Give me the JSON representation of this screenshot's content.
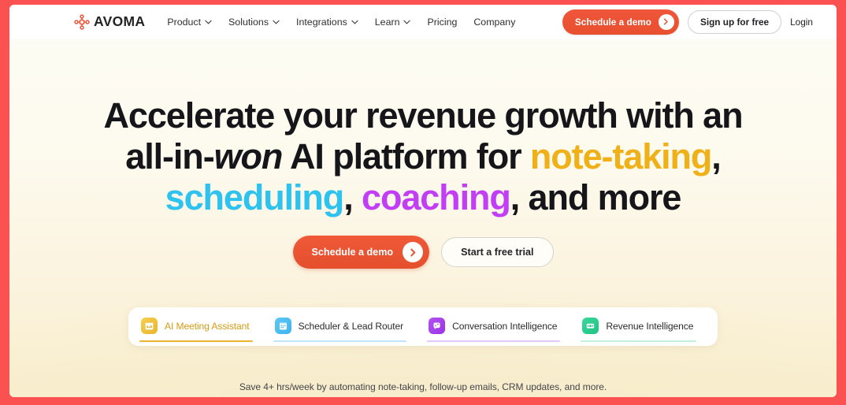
{
  "nav": {
    "brand": {
      "name": "AVOMA",
      "icon": "avoma-logo-icon"
    },
    "links": [
      {
        "label": "Product",
        "has_dropdown": true
      },
      {
        "label": "Solutions",
        "has_dropdown": true
      },
      {
        "label": "Integrations",
        "has_dropdown": true
      },
      {
        "label": "Learn",
        "has_dropdown": true
      },
      {
        "label": "Pricing",
        "has_dropdown": false
      },
      {
        "label": "Company",
        "has_dropdown": false
      }
    ],
    "cta_demo": "Schedule a demo",
    "cta_signup": "Sign up for free",
    "cta_login": "Login"
  },
  "hero": {
    "headline": {
      "line1": "Accelerate your revenue growth with an",
      "line2_a": "all-in-",
      "line2_won": "won",
      "line2_b": " AI platform for ",
      "line2_note": "note-taking",
      "line2_c": ",",
      "line3_sched": "scheduling",
      "line3_a": ", ",
      "line3_coach": "coaching",
      "line3_b": ", and more"
    },
    "cta_primary": "Schedule a demo",
    "cta_secondary": "Start a free trial",
    "caption": "Save 4+ hrs/week by automating note-taking, follow-up emails, CRM updates, and more."
  },
  "tabs": [
    {
      "label": "AI Meeting Assistant",
      "icon": "calendar-notes-icon",
      "active": true,
      "icon_bg_from": "#f6cf4e",
      "icon_bg_to": "#e9b52f",
      "underline": "#e9b52f"
    },
    {
      "label": "Scheduler & Lead Router",
      "icon": "calendar-grid-icon",
      "active": false,
      "icon_bg_from": "#5ec8f5",
      "icon_bg_to": "#3fb4ed",
      "underline": "#bfe6f8"
    },
    {
      "label": "Conversation Intelligence",
      "icon": "sparkle-chat-icon",
      "active": false,
      "icon_bg_from": "#b352f0",
      "icon_bg_to": "#9b34e6",
      "underline": "#e2c6f8"
    },
    {
      "label": "Revenue Intelligence",
      "icon": "money-card-icon",
      "active": false,
      "icon_bg_from": "#3ad69a",
      "icon_bg_to": "#21c386",
      "underline": "#c3efdc"
    }
  ],
  "theme": {
    "frame": "#fb5151",
    "brand_red": "#ea5130",
    "accent_amber": "#f0b018",
    "accent_cyan": "#2ec2ef",
    "accent_purple": "#c23ef4",
    "ink": "#16161a",
    "hero_bg_top": "#fdfcf4",
    "hero_bg_bottom": "#f9eecd"
  }
}
